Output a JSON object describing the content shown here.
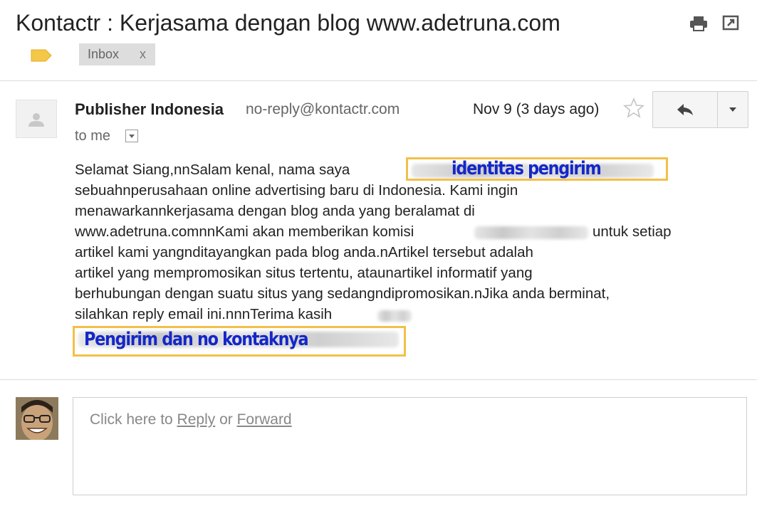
{
  "header": {
    "subject": "Kontactr : Kerjasama dengan blog www.adetruna.com",
    "label_chip": "Inbox",
    "label_chip_close": "x",
    "icons": [
      "print-icon",
      "new-window-icon",
      "label-icon"
    ]
  },
  "message": {
    "sender_name": "Publisher Indonesia",
    "sender_email": "no-reply@kontactr.com",
    "date": "Nov 9 (3 days ago)",
    "recipient": "to me",
    "body_lines": [
      "Selamat Siang,nnSalam kenal, nama saya",
      "sebuahnperusahaan online advertising baru di Indonesia. Kami ingin",
      "menawarkannkerjasama dengan blog anda yang beralamat di",
      "www.adetruna.comnnKami akan memberikan komisi",
      "untuk setiap",
      "artikel kami yangnditayangkan pada blog anda.nArtikel tersebut adalah",
      "artikel yang mempromosikan situs tertentu, ataunartikel informatif yang",
      "berhubungan dengan suatu situs yang sedangndipromosikan.nJika anda berminat,",
      "silahkan reply email ini.nnnTerima kasih"
    ],
    "annotations": {
      "sender_identity": "identitas pengirim",
      "sender_contact": "Pengirim dan no kontaknya"
    },
    "icons": [
      "avatar-placeholder-icon",
      "star-icon",
      "reply-icon",
      "chevron-down-icon"
    ]
  },
  "reply": {
    "prefix": "Click here to ",
    "reply_link": "Reply",
    "middle": " or ",
    "forward_link": "Forward"
  },
  "colors": {
    "annotation_text": "#1427c8",
    "highlight_border": "#f2c04a",
    "chip_background": "#dddddd"
  }
}
